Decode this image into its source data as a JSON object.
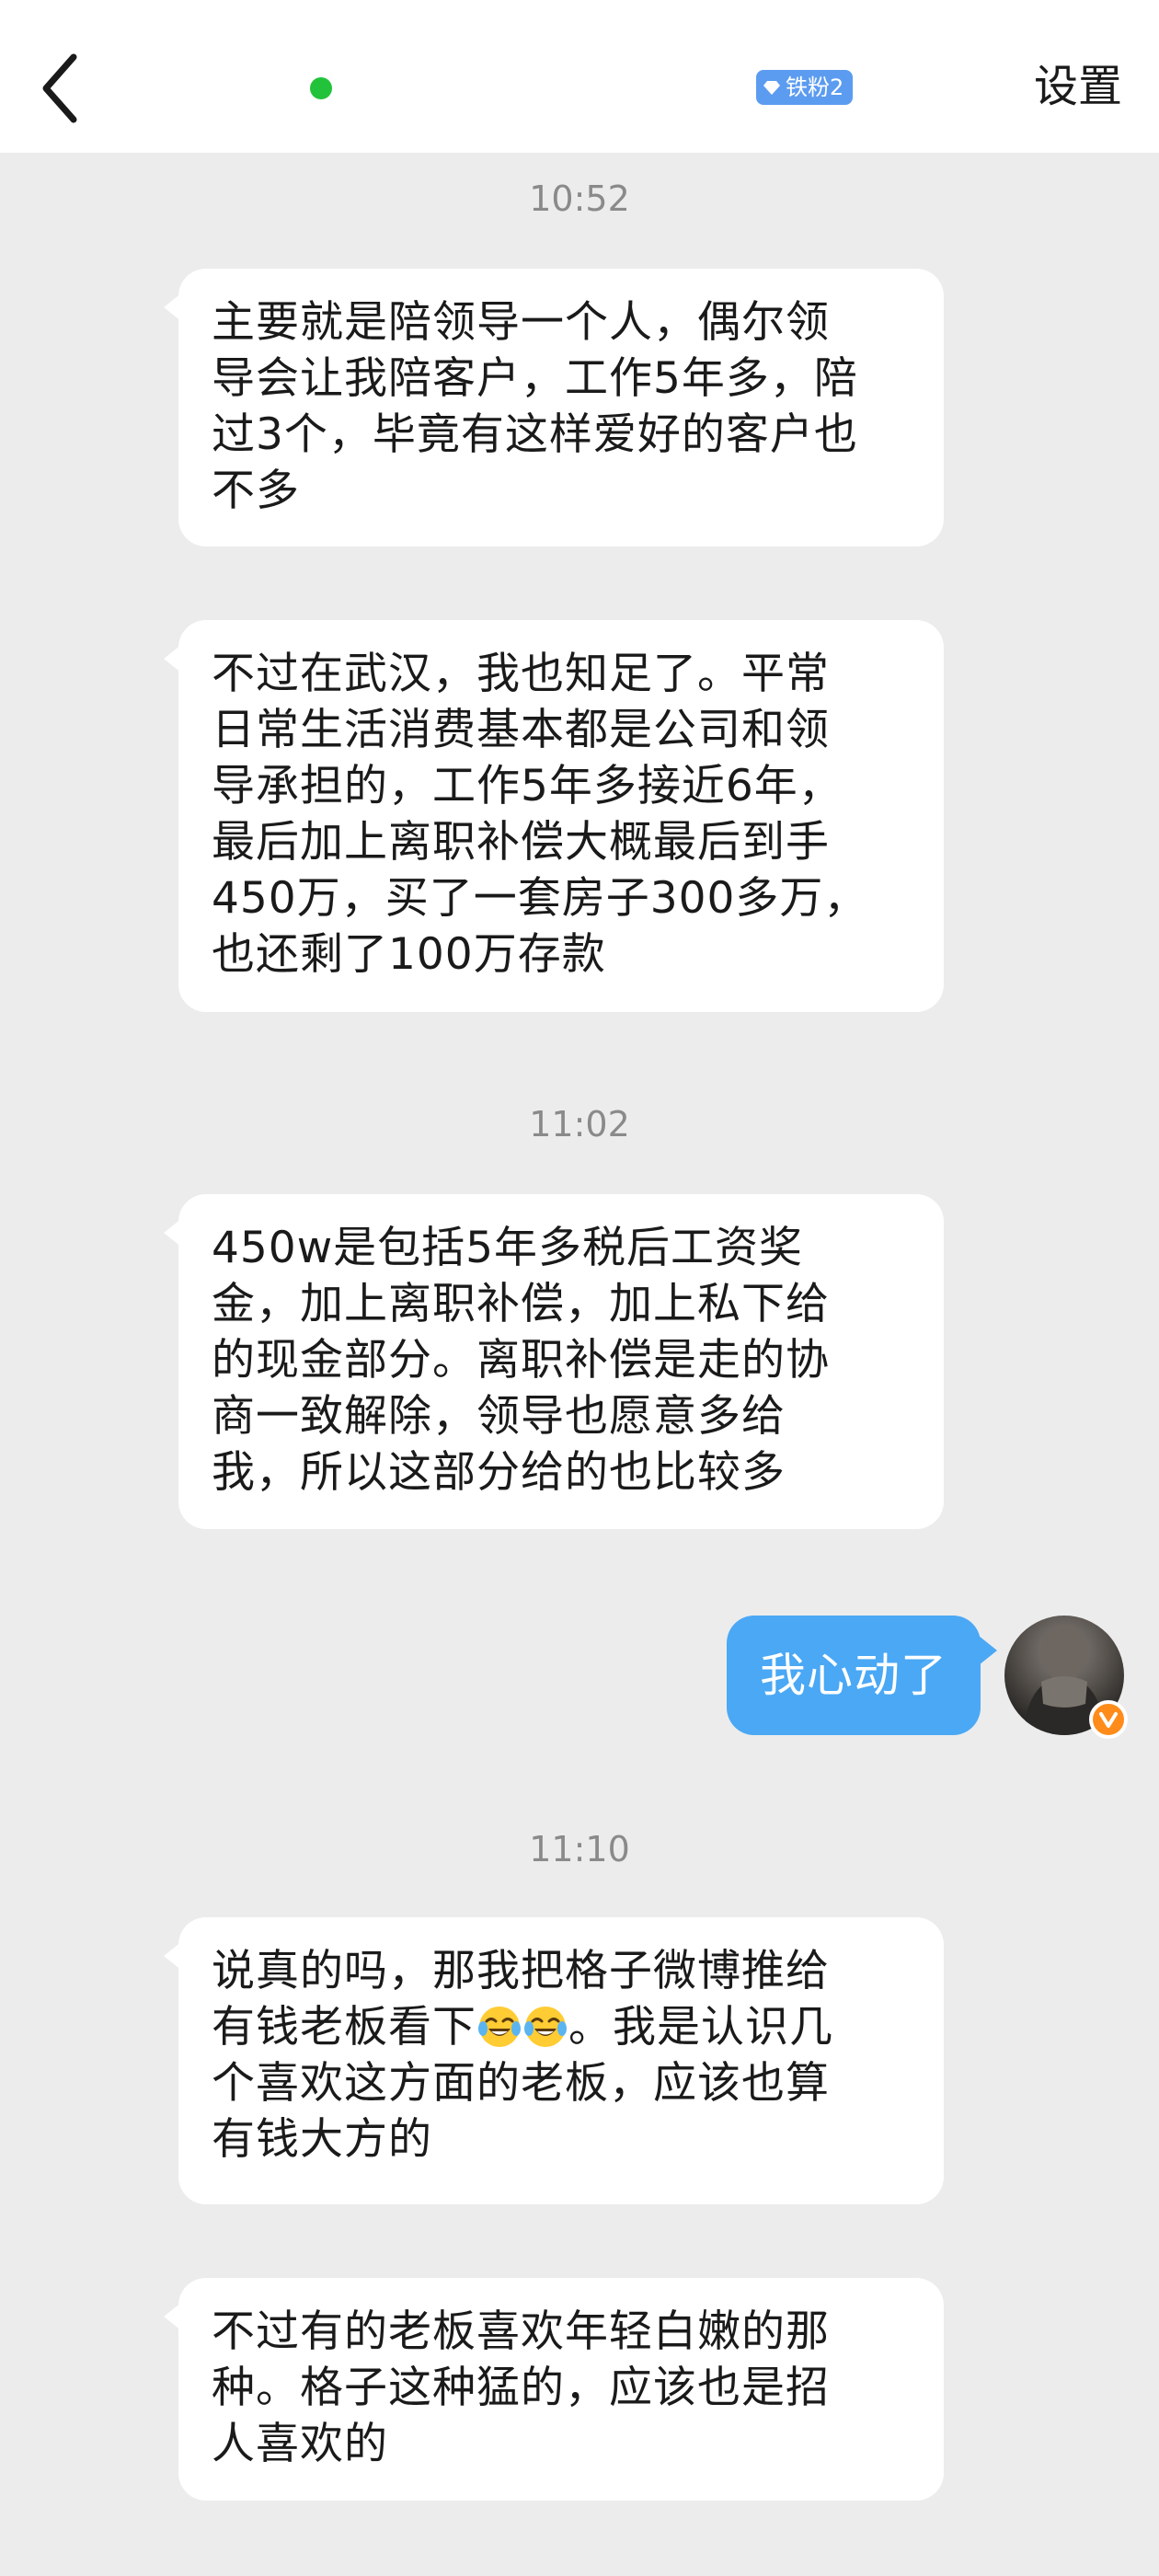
{
  "header": {
    "badge_text": "铁粉2",
    "settings_label": "设置",
    "online_color": "#22c33a",
    "badge_color": "#5c9cf0"
  },
  "messages": [
    {
      "type": "time",
      "text": "10:52"
    },
    {
      "type": "incoming",
      "lines": [
        "主要就是陪领导一个人，偶尔领",
        "导会让我陪客户，工作5年多，陪",
        "过3个，毕竟有这样爱好的客户也",
        "不多"
      ]
    },
    {
      "type": "incoming",
      "lines": [
        "不过在武汉，我也知足了。平常",
        "日常生活消费基本都是公司和领",
        "导承担的，工作5年多接近6年，",
        "最后加上离职补偿大概最后到手",
        "450万，买了一套房子300多万，",
        "也还剩了100万存款"
      ]
    },
    {
      "type": "time",
      "text": "11:02"
    },
    {
      "type": "incoming",
      "lines": [
        "450w是包括5年多税后工资奖",
        "金，加上离职补偿，加上私下给",
        "的现金部分。离职补偿是走的协",
        "商一致解除，领导也愿意多给",
        "我，所以这部分给的也比较多"
      ]
    },
    {
      "type": "outgoing",
      "text": "我心动了"
    },
    {
      "type": "time",
      "text": "11:10"
    },
    {
      "type": "incoming",
      "lines": [
        "说真的吗，那我把格子微博推给",
        "有钱老板看下",
        "。我是认识几",
        "个喜欢这方面的老板，应该也算",
        "有钱大方的"
      ]
    },
    {
      "type": "incoming",
      "lines": [
        "不过有的老板喜欢年轻白嫩的那",
        "种。格子这种猛的，应该也是招",
        "人喜欢的"
      ]
    }
  ],
  "icons": {
    "back": "chevron-left-icon",
    "emoji": "tears-of-joy-emoji",
    "verified": "verified-v-icon",
    "badge": "diamond-icon"
  },
  "colors": {
    "outgoing_bubble": "#4aa8f5",
    "incoming_bubble": "#ffffff",
    "background": "#ececec",
    "verified": "#ff8c1a"
  }
}
